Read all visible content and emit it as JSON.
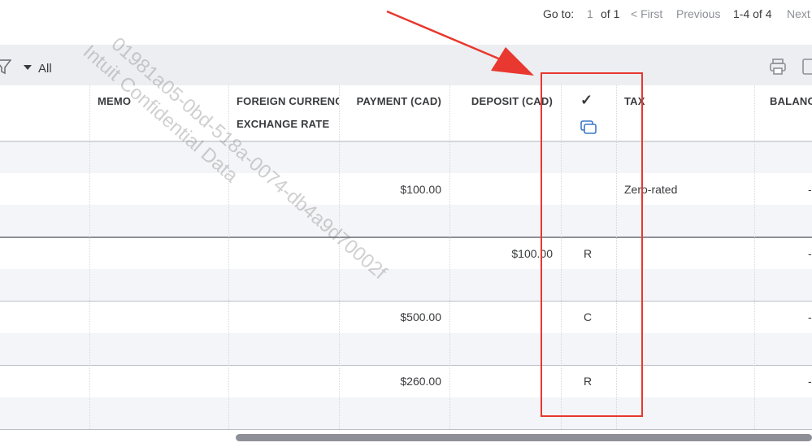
{
  "pager": {
    "goto_label": "Go to:",
    "page": "1",
    "of_label": "of 1",
    "first": "< First",
    "previous": "Previous",
    "range": "1-4 of 4",
    "next": "Next"
  },
  "toolbar": {
    "filter_icon": "filter-icon",
    "all_label": "All",
    "print_icon": "printer-icon",
    "export_icon": "export-icon"
  },
  "columns": {
    "memo": "MEMO",
    "foreign_line1": "FOREIGN CURRENC",
    "foreign_line2": "EXCHANGE RATE",
    "payment": "PAYMENT (CAD)",
    "deposit": "DEPOSIT (CAD)",
    "check": "✓",
    "copy_icon": "copy-icon",
    "tax": "TAX",
    "balance": "BALANC"
  },
  "rows": [
    {
      "payment": "$100.00",
      "deposit": "",
      "status": "",
      "tax": "Zero-rated",
      "balance": "-"
    },
    {
      "payment": "",
      "deposit": "$100.00",
      "status": "R",
      "tax": "",
      "balance": "-"
    },
    {
      "payment": "$500.00",
      "deposit": "",
      "status": "C",
      "tax": "",
      "balance": "-"
    },
    {
      "payment": "$260.00",
      "deposit": "",
      "status": "R",
      "tax": "",
      "balance": "-"
    }
  ],
  "watermark": {
    "line1": "01981a05-0bd-518a-0074-db4a9d70002f",
    "line2": "Intuit Confidential Data"
  },
  "colors": {
    "annotation": "#e8382f",
    "band": "#f4f5f8",
    "toolbar": "#eceef1"
  }
}
